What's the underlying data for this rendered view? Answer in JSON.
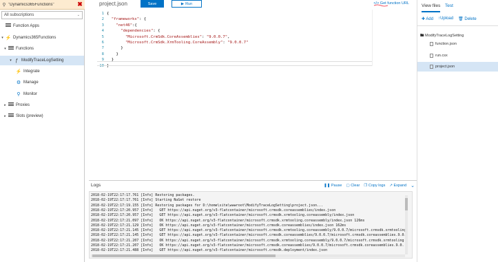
{
  "sidebar": {
    "search_value": "\"Dynamics365Functions\"",
    "subscription": "All subscriptions",
    "items": [
      {
        "label": "Function Apps"
      },
      {
        "label": "Dynamics365Functions"
      },
      {
        "label": "Functions"
      },
      {
        "label": "ModifyTraceLogSetting"
      },
      {
        "label": "Integrate"
      },
      {
        "label": "Manage"
      },
      {
        "label": "Monitor"
      },
      {
        "label": "Proxies"
      },
      {
        "label": "Slots (preview)"
      }
    ]
  },
  "toolbar": {
    "filename": "project.json",
    "save_label": "Save",
    "run_label": "Run",
    "get_url_label": "</> Get function URL"
  },
  "editor": {
    "lines": [
      {
        "num": "1",
        "text": "{"
      },
      {
        "num": "2",
        "text": "  \"frameworks\": {"
      },
      {
        "num": "3",
        "text": "    \"net46\":{"
      },
      {
        "num": "4",
        "text": "      \"dependencies\": {"
      },
      {
        "num": "5",
        "text": "        \"Microsoft.CrmSdk.CoreAssemblies\": \"9.0.0.7\","
      },
      {
        "num": "6",
        "text": "        \"Microsoft.CrmSdk.XrmTooling.CoreAssembly\": \"9.0.0.7\""
      },
      {
        "num": "7",
        "text": "      }"
      },
      {
        "num": "8",
        "text": "    }"
      },
      {
        "num": "9",
        "text": "  }"
      },
      {
        "num": "10",
        "text": "}"
      }
    ]
  },
  "logs": {
    "title": "Logs",
    "pause_label": "Pause",
    "clear_label": "Clear",
    "copy_label": "Copy logs",
    "expand_label": "Expand",
    "lines": [
      "2018-02-19T22:17:17.761 [Info] Restoring packages.",
      "2018-02-19T22:17:17.761 [Info] Starting NuGet restore",
      "2018-02-19T22:17:19.155 [Info] Restoring packages for D:\\home\\site\\wwwroot\\ModifyTraceLogSetting\\project.json...",
      "2018-02-19T22:17:20.957 [Info]   GET https://api.nuget.org/v3-flatcontainer/microsoft.crmsdk.coreassemblies/index.json",
      "2018-02-19T22:17:20.957 [Info]   GET https://api.nuget.org/v3-flatcontainer/microsoft.crmsdk.xrmtooling.coreassembly/index.json",
      "2018-02-19T22:17:21.097 [Info]   OK https://api.nuget.org/v3-flatcontainer/microsoft.crmsdk.xrmtooling.coreassembly/index.json 126ms",
      "2018-02-19T22:17:21.129 [Info]   OK https://api.nuget.org/v3-flatcontainer/microsoft.crmsdk.coreassemblies/index.json 162ms",
      "2018-02-19T22:17:21.145 [Info]   GET https://api.nuget.org/v3-flatcontainer/microsoft.crmsdk.xrmtooling.coreassembly/9.0.0.7/microsoft.crmsdk.xrmtooling",
      "2018-02-19T22:17:21.145 [Info]   GET https://api.nuget.org/v3-flatcontainer/microsoft.crmsdk.coreassemblies/9.0.0.7/microsoft.crmsdk.coreassemblies.9.0.",
      "2018-02-19T22:17:21.207 [Info]   OK https://api.nuget.org/v3-flatcontainer/microsoft.crmsdk.xrmtooling.coreassembly/9.0.0.7/microsoft.crmsdk.xrmtooling",
      "2018-02-19T22:17:21.207 [Info]   OK https://api.nuget.org/v3-flatcontainer/microsoft.crmsdk.coreassemblies/9.0.0.7/microsoft.crmsdk.coreassemblies.9.0.",
      "2018-02-19T22:17:21.488 [Info]   GET https://api.nuget.org/v3-flatcontainer/microsoft.crmsdk.deployment/index.json"
    ]
  },
  "right_panel": {
    "tab_view_files": "View files",
    "tab_test": "Test",
    "add_label": "Add",
    "upload_label": "Upload",
    "delete_label": "Delete",
    "folder": "ModifyTraceLogSetting",
    "files": [
      "function.json",
      "run.csx",
      "project.json"
    ]
  },
  "colors": {
    "accent": "#0072c6",
    "selected_bg": "#d5e5f5",
    "search_bg": "#fdebd0"
  }
}
